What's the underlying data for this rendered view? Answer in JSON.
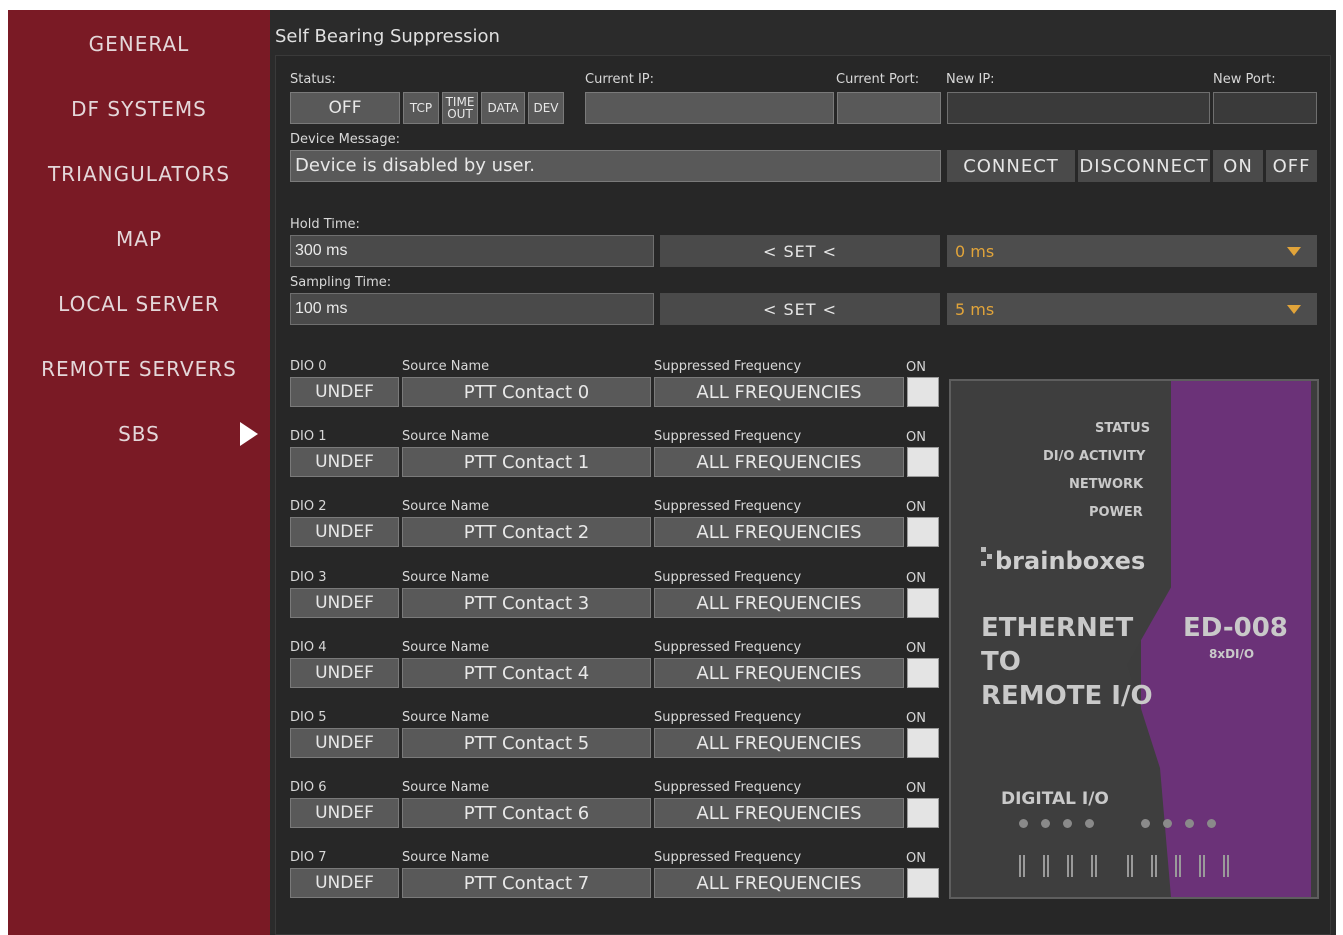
{
  "sidebar": {
    "items": [
      {
        "label": "GENERAL"
      },
      {
        "label": "DF SYSTEMS"
      },
      {
        "label": "TRIANGULATORS"
      },
      {
        "label": "MAP"
      },
      {
        "label": "LOCAL SERVER"
      },
      {
        "label": "REMOTE SERVERS"
      },
      {
        "label": "SBS",
        "selected": true
      }
    ]
  },
  "header": {
    "title": "Self Bearing Suppression"
  },
  "connection": {
    "status_label": "Status:",
    "status_value": "OFF",
    "flags": {
      "tcp": "TCP",
      "timeout_1": "TIME",
      "timeout_2": "OUT",
      "data": "DATA",
      "dev": "DEV"
    },
    "current_ip_label": "Current IP:",
    "current_ip_value": "",
    "current_port_label": "Current Port:",
    "current_port_value": "",
    "new_ip_label": "New IP:",
    "new_ip_value": "",
    "new_port_label": "New Port:",
    "new_port_value": "",
    "device_message_label": "Device Message:",
    "device_message": "Device is disabled by user.",
    "buttons": {
      "connect": "CONNECT",
      "disconnect": "DISCONNECT",
      "on": "ON",
      "off": "OFF"
    }
  },
  "timing": {
    "hold_label": "Hold Time:",
    "hold_value": "300 ms",
    "hold_set": "< SET <",
    "hold_option": "0 ms",
    "sampling_label": "Sampling Time:",
    "sampling_value": "100 ms",
    "sampling_set": "< SET <",
    "sampling_option": "5 ms"
  },
  "dio_headers": {
    "source": "Source Name",
    "frequency": "Suppressed Frequency",
    "on": "ON"
  },
  "dio": [
    {
      "label": "DIO 0",
      "state": "UNDEF",
      "source": "PTT Contact 0",
      "frequency": "ALL FREQUENCIES"
    },
    {
      "label": "DIO 1",
      "state": "UNDEF",
      "source": "PTT Contact 1",
      "frequency": "ALL FREQUENCIES"
    },
    {
      "label": "DIO 2",
      "state": "UNDEF",
      "source": "PTT Contact 2",
      "frequency": "ALL FREQUENCIES"
    },
    {
      "label": "DIO 3",
      "state": "UNDEF",
      "source": "PTT Contact 3",
      "frequency": "ALL FREQUENCIES"
    },
    {
      "label": "DIO 4",
      "state": "UNDEF",
      "source": "PTT Contact 4",
      "frequency": "ALL FREQUENCIES"
    },
    {
      "label": "DIO 5",
      "state": "UNDEF",
      "source": "PTT Contact 5",
      "frequency": "ALL FREQUENCIES"
    },
    {
      "label": "DIO 6",
      "state": "UNDEF",
      "source": "PTT Contact 6",
      "frequency": "ALL FREQUENCIES"
    },
    {
      "label": "DIO 7",
      "state": "UNDEF",
      "source": "PTT Contact 7",
      "frequency": "ALL FREQUENCIES"
    }
  ],
  "device_image": {
    "status": "STATUS",
    "dio_activity": "DI/O ACTIVITY",
    "network": "NETWORK",
    "power": "POWER",
    "brand": "brainboxes",
    "line1": "ETHERNET",
    "line2": "TO",
    "line3": "REMOTE I/O",
    "model": "ED-008",
    "model_sub": "8xDI/O",
    "digital": "DIGITAL I/O"
  },
  "colors": {
    "sidebar": "#7a1a25",
    "panel": "#272727",
    "accent": "#e1a43a",
    "device_purple": "#6b3278"
  }
}
